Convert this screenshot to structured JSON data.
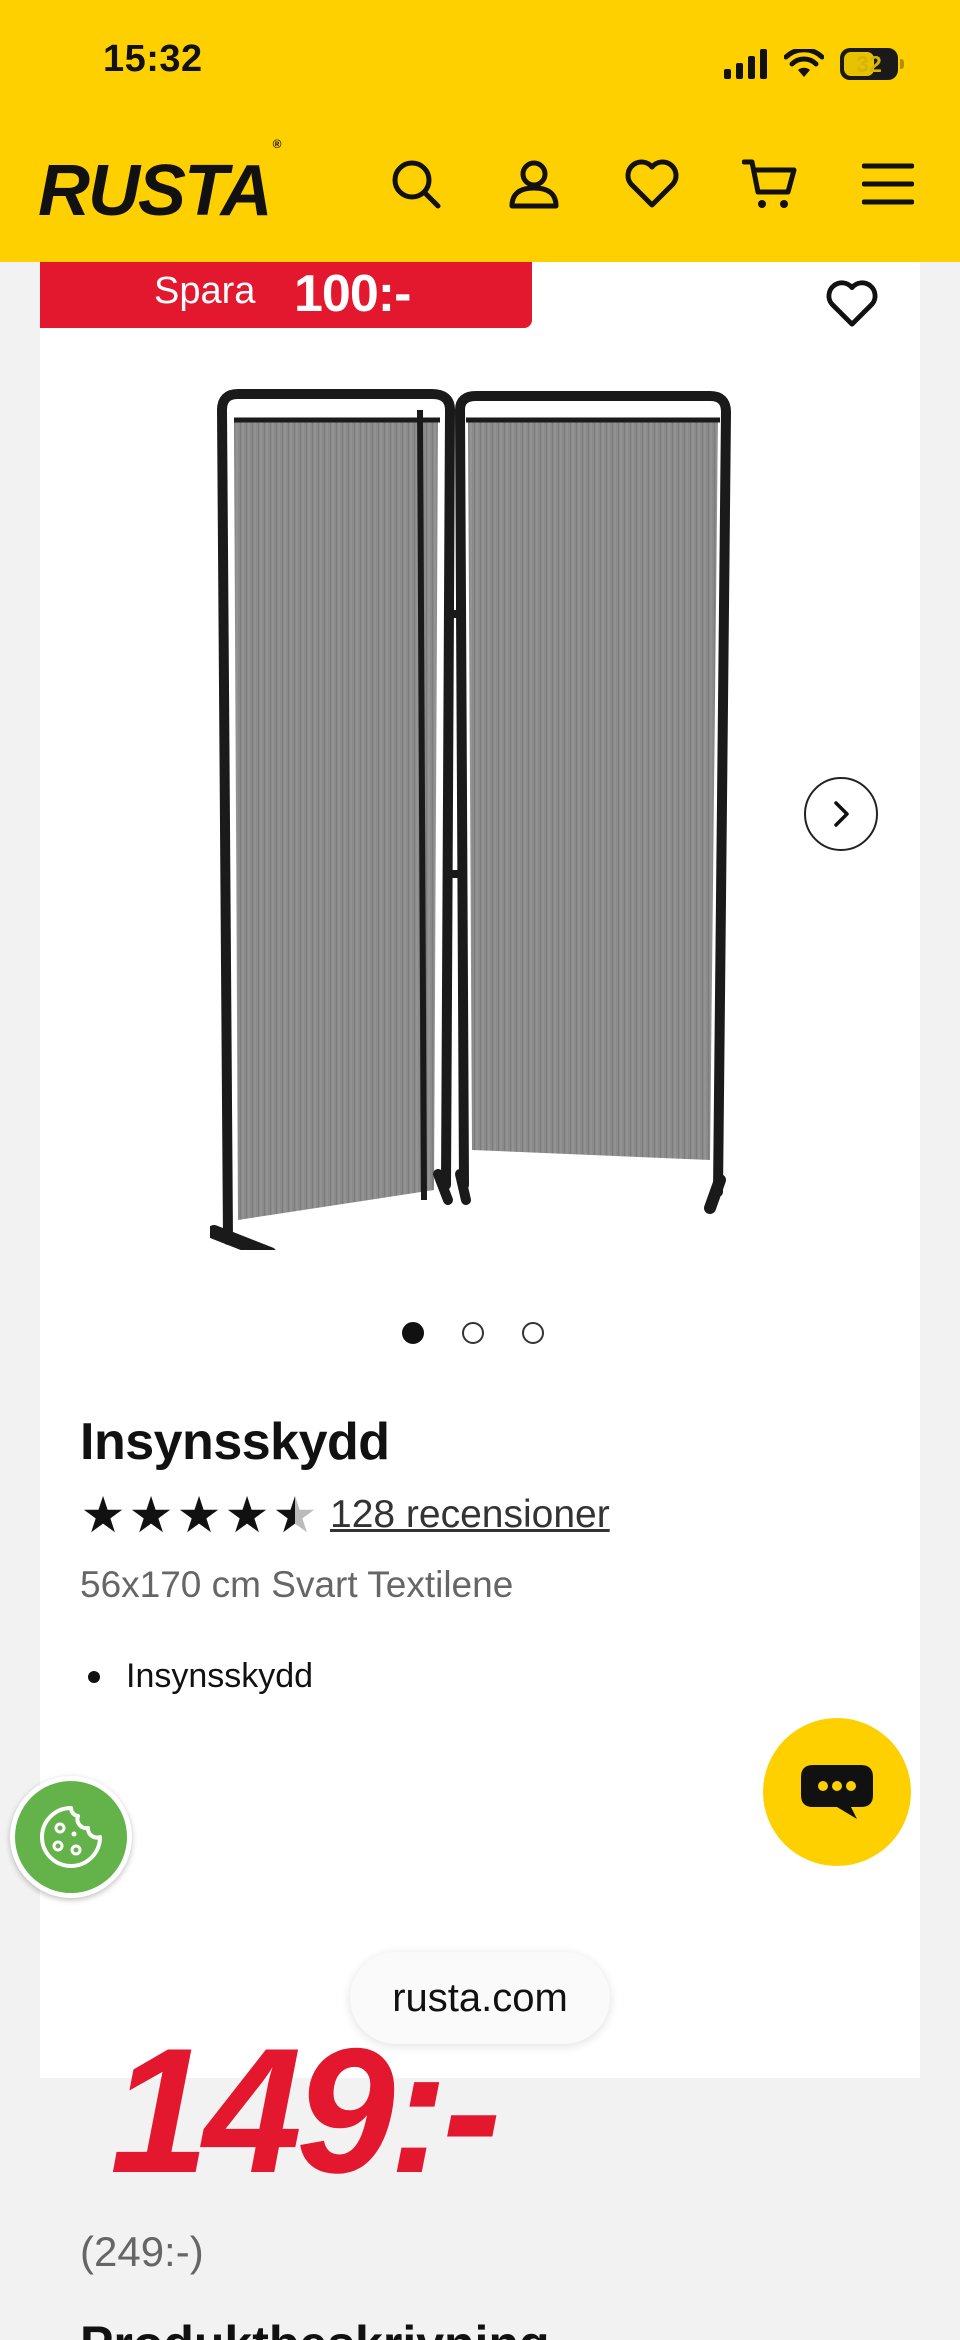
{
  "status_bar": {
    "time": "15:32",
    "battery": "32"
  },
  "header": {
    "logo": "RUSTA",
    "logo_mark": "®",
    "icons": [
      "search-icon",
      "account-icon",
      "heart-icon",
      "cart-icon",
      "menu-icon"
    ]
  },
  "product": {
    "save_label": "Spara",
    "save_amount": "100:-",
    "image_count": 3,
    "active_image": 1,
    "title": "Insynsskydd",
    "rating": 4.5,
    "reviews": "128 recensioner",
    "variant": "56x170 cm Svart Textilene",
    "bullets": [
      "Insynsskydd"
    ],
    "price": "149:-",
    "old_price": "(249:-)",
    "next_heading": "Produktbeskrivning"
  },
  "browser": {
    "url": "rusta.com"
  },
  "colors": {
    "brand_yellow": "#ffd000",
    "sale_red": "#e3172d",
    "cookie_green": "#64b34a"
  }
}
